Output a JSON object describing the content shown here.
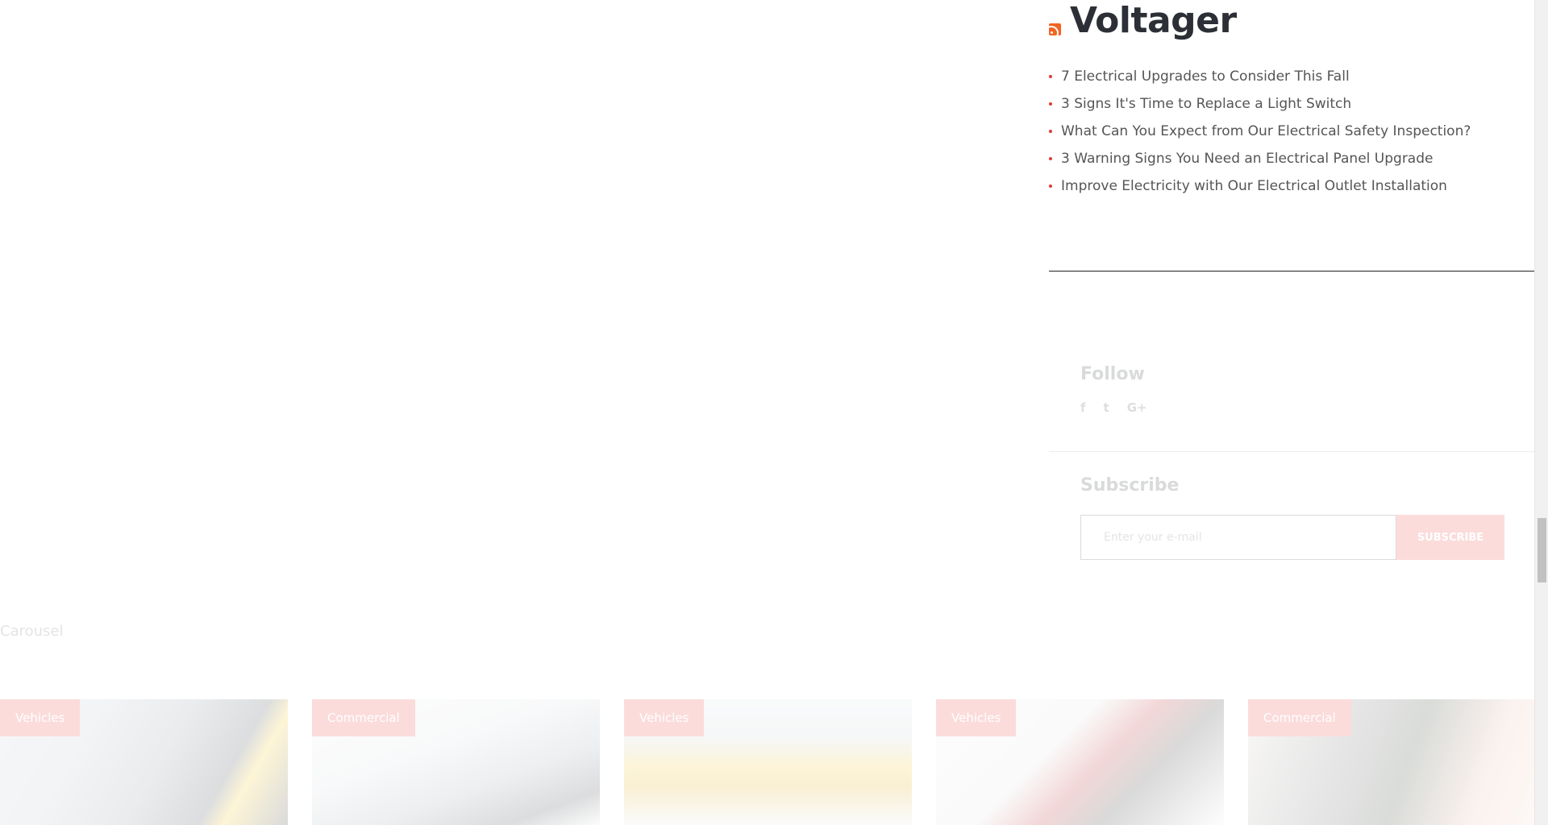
{
  "rss_widget": {
    "title": "Voltager",
    "icon": "rss-icon",
    "items": [
      "7 Electrical Upgrades to Consider This Fall",
      "3 Signs It's Time to Replace a Light Switch",
      "What Can You Expect from Our Electrical Safety Inspection?",
      "3 Warning Signs You Need an Electrical Panel Upgrade",
      "Improve Electricity with Our Electrical Outlet Installation"
    ]
  },
  "follow": {
    "title": "Follow",
    "icons": [
      "f",
      "t",
      "G+"
    ]
  },
  "subscribe": {
    "title": "Subscribe",
    "placeholder": "Enter your e-mail",
    "button_label": "SUBSCRIBE"
  },
  "carousel": {
    "label": "Carousel",
    "cards": [
      {
        "tag": "Vehicles"
      },
      {
        "tag": "Commercial"
      },
      {
        "tag": "Vehicles"
      },
      {
        "tag": "Vehicles"
      },
      {
        "tag": "Commercial"
      }
    ]
  },
  "colors": {
    "accent": "#e53935",
    "heading": "#2c2f36",
    "rss": "#f26522"
  }
}
